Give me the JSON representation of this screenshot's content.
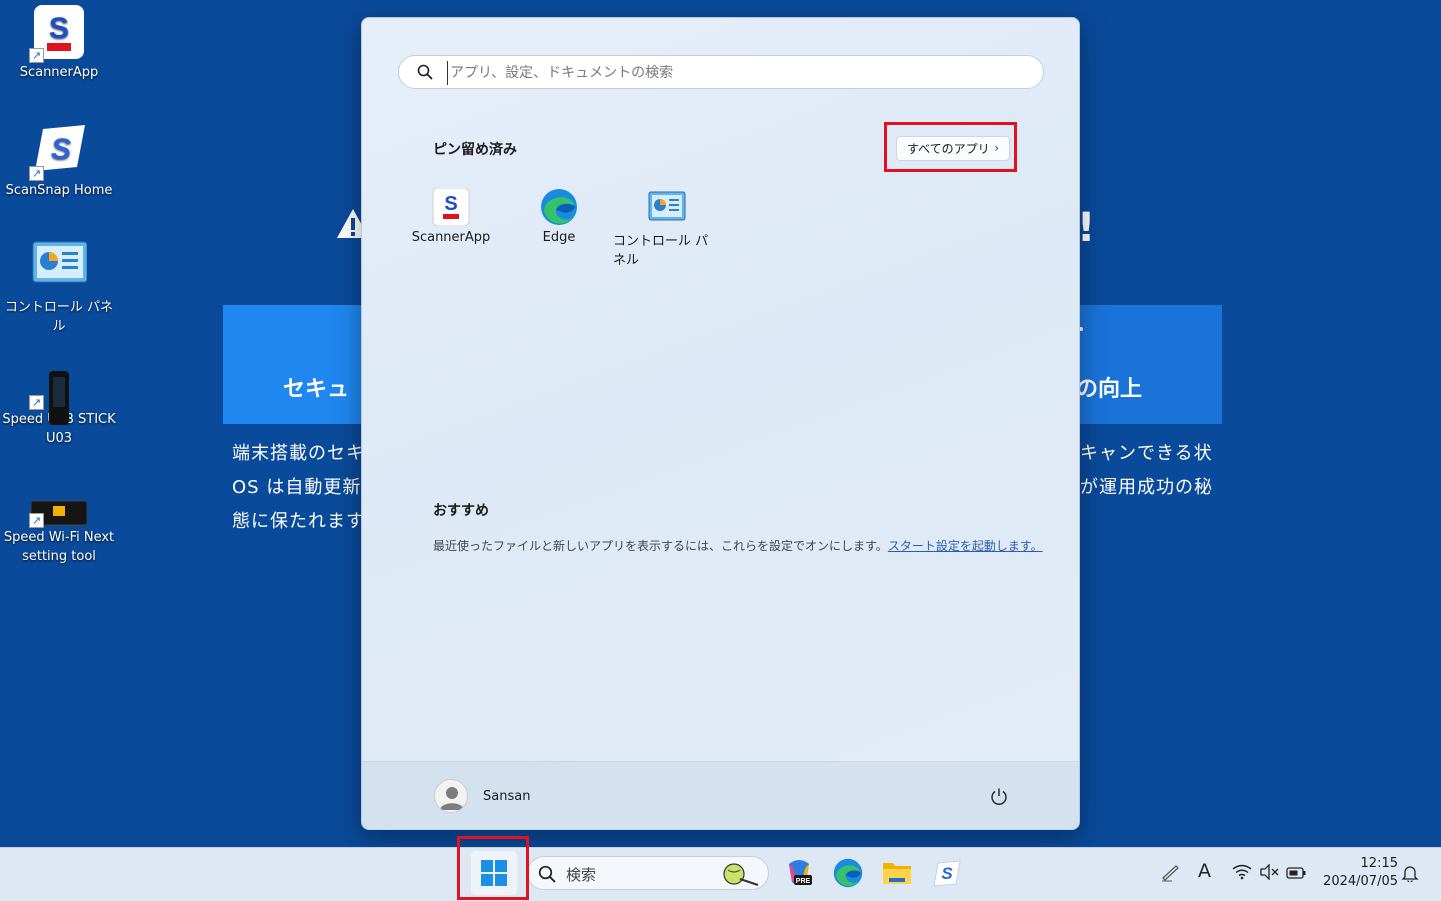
{
  "desktop": {
    "icons": [
      {
        "label": "ScannerApp",
        "icon": "scannerapp-icon"
      },
      {
        "label": "ScanSnap Home",
        "icon": "scansnap-home-icon"
      },
      {
        "label": "コントロール パネル",
        "icon": "control-panel-icon"
      },
      {
        "label": "Speed USB STICK\nU03",
        "icon": "usb-stick-icon"
      },
      {
        "label": "Speed Wi-Fi Next\nsetting tool",
        "icon": "wifi-router-icon"
      }
    ]
  },
  "background_page": {
    "card_left_title": "セキュ",
    "card_right_title": "の向上",
    "text_left": "端末搭載のセキ\nOS は自動更新\n態に保たれます",
    "text_right": "キャンできる状\nが運用成功の秘",
    "warning_icon": "warning-icon",
    "accent_color": "#1f87ef"
  },
  "start_menu": {
    "search_placeholder": "アプリ、設定、ドキュメントの検索",
    "pinned_title": "ピン留め済み",
    "all_apps_label": "すべてのアプリ",
    "pinned_apps": [
      {
        "label": "ScannerApp",
        "icon": "scannerapp-icon"
      },
      {
        "label": "Edge",
        "icon": "edge-icon"
      },
      {
        "label": "コントロール パネル",
        "icon": "control-panel-icon"
      }
    ],
    "recommended_title": "おすすめ",
    "recommended_text": "最近使ったファイルと新しいアプリを表示するには、これらを設定でオンにします。",
    "recommended_link": "スタート設定を起動します。",
    "user_name": "Sansan",
    "highlight_color": "#e0121f"
  },
  "taskbar": {
    "search_label": "検索",
    "apps": [
      "copilot-icon",
      "edge-icon",
      "file-explorer-icon",
      "scansnap-icon"
    ],
    "tray": {
      "pen_icon": "pen-icon",
      "ime_label": "A",
      "wifi_icon": "wifi-icon",
      "volume_icon": "volume-muted-icon",
      "battery_icon": "battery-icon"
    },
    "time": "12:15",
    "date": "2024/07/05",
    "notification_icon": "bell-icon"
  }
}
